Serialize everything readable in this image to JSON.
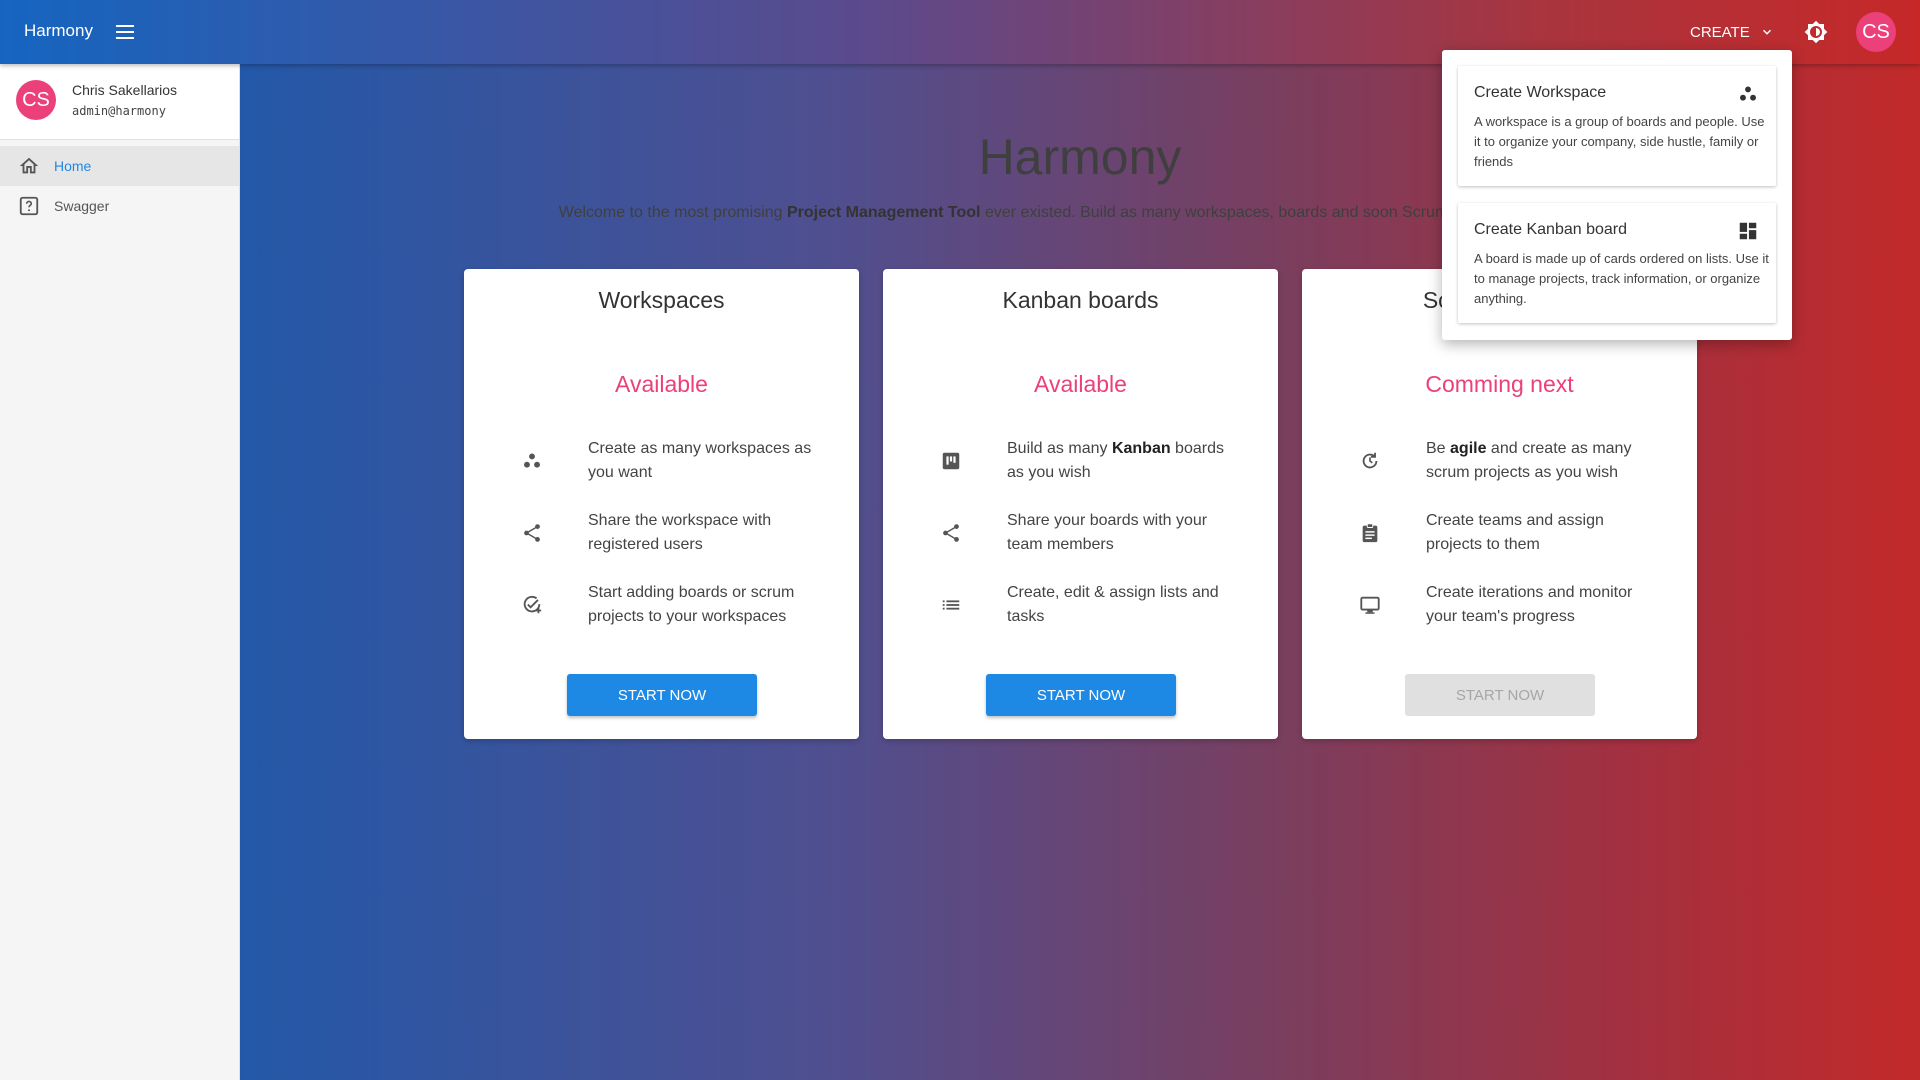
{
  "app": {
    "brand": "Harmony"
  },
  "topbar": {
    "create_label": "CREATE",
    "avatar_initials": "CS"
  },
  "sidebar": {
    "user": {
      "initials": "CS",
      "name": "Chris Sakellarios",
      "email": "admin@harmony"
    },
    "items": [
      {
        "label": "Home",
        "icon": "home-icon",
        "active": true
      },
      {
        "label": "Swagger",
        "icon": "help-icon",
        "active": false
      }
    ]
  },
  "hero": {
    "title": "Harmony",
    "subtitle_pre": "Welcome to the most promising ",
    "subtitle_bold": "Project Management Tool",
    "subtitle_post": " ever existed. Build as many workspaces, boards and soon Scrum projects as you wish."
  },
  "cards": [
    {
      "title": "Workspaces",
      "status": "Available",
      "features": [
        {
          "icon": "group-work-icon",
          "text": "Create as many workspaces as you want"
        },
        {
          "icon": "share-icon",
          "text": "Share the workspace with registered users"
        },
        {
          "icon": "add-task-icon",
          "text": "Start adding boards or scrum projects to your workspaces"
        }
      ],
      "button": "START NOW",
      "button_enabled": true
    },
    {
      "title": "Kanban boards",
      "status": "Available",
      "features": [
        {
          "icon": "kanban-icon",
          "pre": "Build as many ",
          "bold": "Kanban",
          "post": " boards as you wish"
        },
        {
          "icon": "share-icon",
          "text": "Share your boards with your team members"
        },
        {
          "icon": "list-icon",
          "text": "Create, edit & assign lists and tasks"
        }
      ],
      "button": "START NOW",
      "button_enabled": true
    },
    {
      "title": "Scrum projects",
      "status": "Comming next",
      "features": [
        {
          "icon": "sprint-icon",
          "pre": "Be ",
          "bold": "agile",
          "post": " and create as many scrum projects as you wish"
        },
        {
          "icon": "clipboard-icon",
          "text": "Create teams and assign projects to them"
        },
        {
          "icon": "monitor-icon",
          "text": "Create iterations and monitor your team's progress"
        }
      ],
      "button": "START NOW",
      "button_enabled": false
    }
  ],
  "create_menu": [
    {
      "title": "Create Workspace",
      "icon": "group-work-icon",
      "description": "A workspace is a group of boards and people. Use it to organize your company, side hustle, family or friends"
    },
    {
      "title": "Create Kanban board",
      "icon": "dashboard-icon",
      "description": "A board is made up of cards ordered on lists. Use it to manage projects, track information, or organize anything."
    }
  ]
}
